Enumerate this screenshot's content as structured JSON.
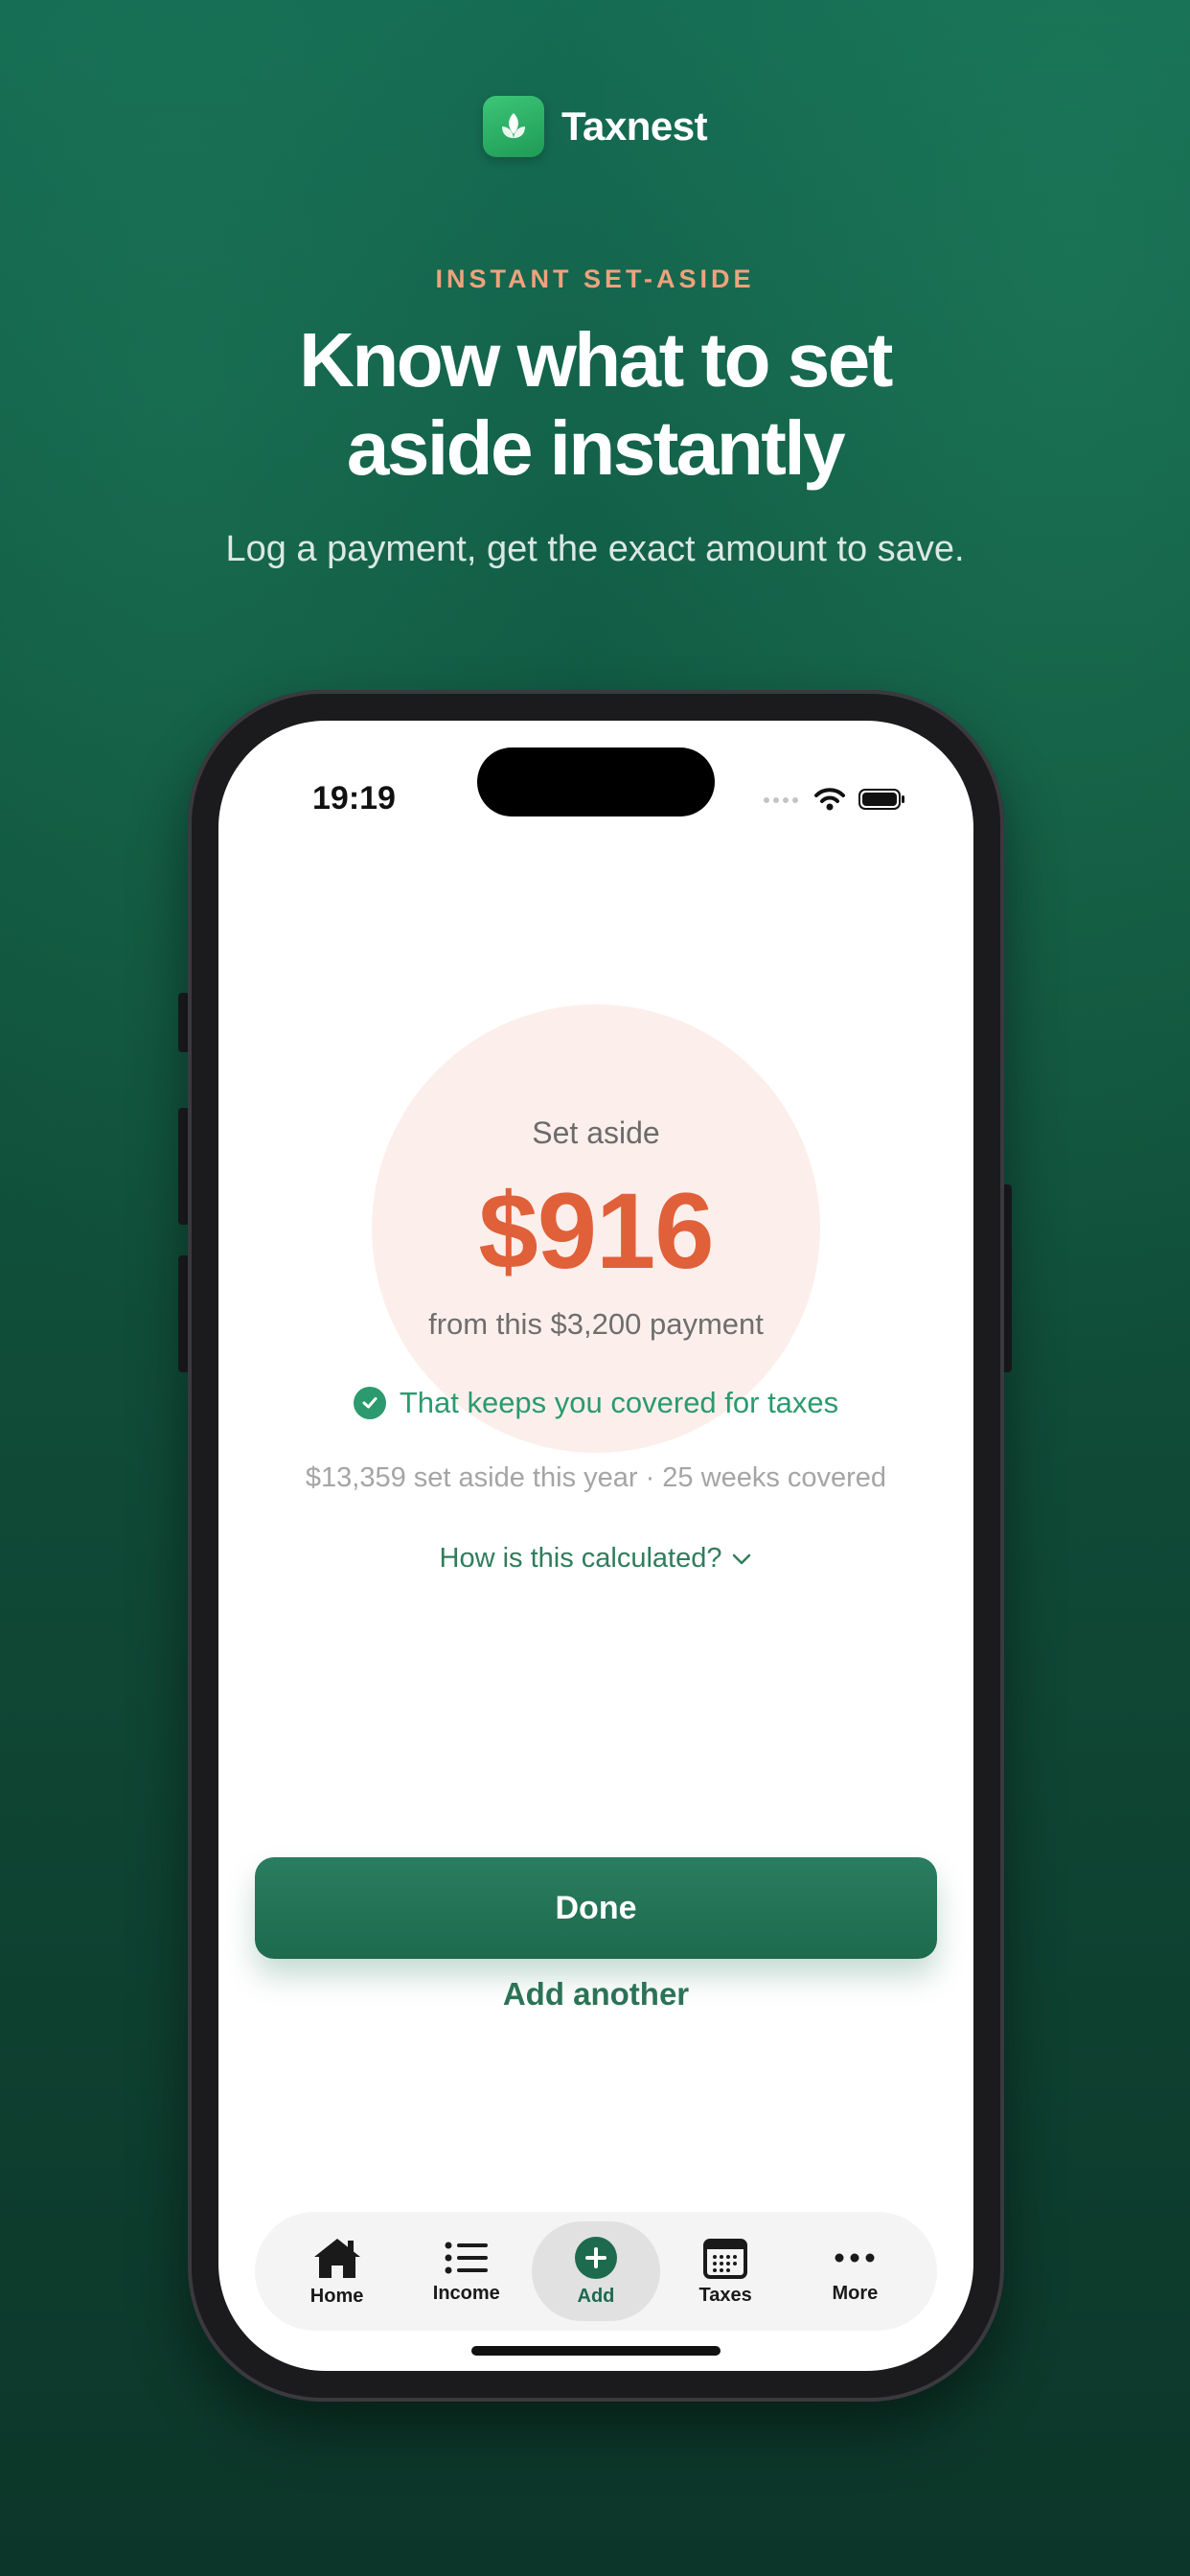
{
  "brand": {
    "name": "Taxnest"
  },
  "hero": {
    "eyebrow": "INSTANT SET-ASIDE",
    "headline_line1": "Know what to set",
    "headline_line2": "aside instantly",
    "subline": "Log a payment, get the exact amount to save."
  },
  "status_bar": {
    "time": "19:19"
  },
  "result": {
    "label": "Set aside",
    "amount": "$916",
    "source": "from this $3,200 payment",
    "covered_message": "That keeps you covered for taxes",
    "stats": "$13,359 set aside this year · 25 weeks covered",
    "how_calculated": "How is this calculated?"
  },
  "actions": {
    "done_label": "Done",
    "add_another_label": "Add another"
  },
  "tabbar": {
    "items": [
      {
        "label": "Home",
        "icon": "home-icon"
      },
      {
        "label": "Income",
        "icon": "list-icon"
      },
      {
        "label": "Add",
        "icon": "plus-circle-icon",
        "active": true
      },
      {
        "label": "Taxes",
        "icon": "calendar-icon"
      },
      {
        "label": "More",
        "icon": "more-icon"
      }
    ]
  },
  "colors": {
    "background_top": "#146b52",
    "background_bottom": "#0c3629",
    "accent_orange": "#e0603a",
    "accent_green": "#2b9a6e",
    "button_green": "#1d6a4f"
  }
}
